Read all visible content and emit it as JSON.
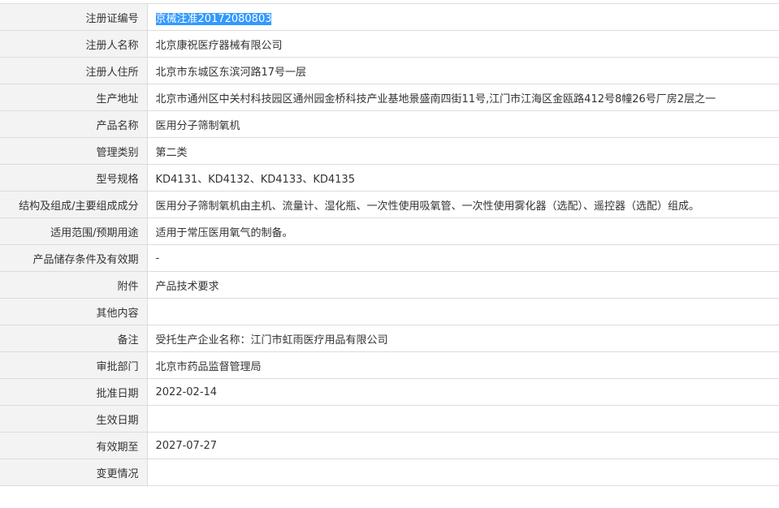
{
  "record": {
    "highlighted_value": "京械注准20172080803",
    "rows": [
      {
        "label": "注册证编号",
        "value": "京械注准20172080803"
      },
      {
        "label": "注册人名称",
        "value": "北京康祝医疗器械有限公司"
      },
      {
        "label": "注册人住所",
        "value": "北京市东城区东滨河路17号一层"
      },
      {
        "label": "生产地址",
        "value": "北京市通州区中关村科技园区通州园金桥科技产业基地景盛南四街11号,江门市江海区金瓯路412号8幢26号厂房2层之一"
      },
      {
        "label": "产品名称",
        "value": "医用分子筛制氧机"
      },
      {
        "label": "管理类别",
        "value": "第二类"
      },
      {
        "label": "型号规格",
        "value": "KD4131、KD4132、KD4133、KD4135"
      },
      {
        "label": "结构及组成/主要组成成分",
        "value": "医用分子筛制氧机由主机、流量计、湿化瓶、一次性使用吸氧管、一次性使用雾化器（选配）、遥控器（选配）组成。"
      },
      {
        "label": "适用范围/预期用途",
        "value": "适用于常压医用氧气的制备。"
      },
      {
        "label": "产品储存条件及有效期",
        "value": "-"
      },
      {
        "label": "附件",
        "value": "产品技术要求"
      },
      {
        "label": "其他内容",
        "value": ""
      },
      {
        "label": "备注",
        "value": "受托生产企业名称：江门市虹雨医疗用品有限公司"
      },
      {
        "label": "审批部门",
        "value": "北京市药品监督管理局"
      },
      {
        "label": "批准日期",
        "value": "2022-02-14"
      },
      {
        "label": "生效日期",
        "value": ""
      },
      {
        "label": "有效期至",
        "value": "2027-07-27"
      },
      {
        "label": "变更情况",
        "value": ""
      }
    ]
  },
  "colors": {
    "label_background": "#f3f3f3",
    "border": "#dcdcdc",
    "selection_highlight": "#3399ff"
  }
}
